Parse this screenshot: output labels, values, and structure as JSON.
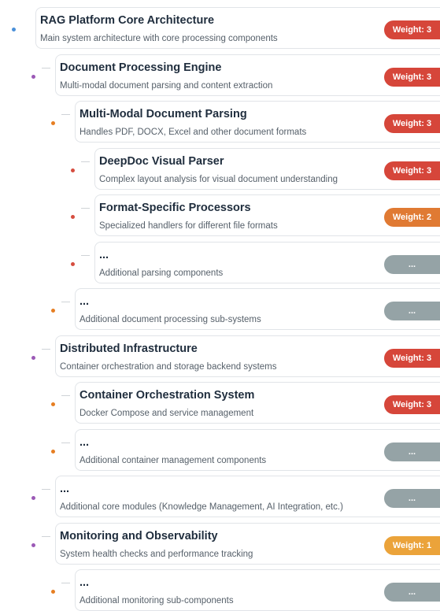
{
  "colors": {
    "dot_root": "#4a90d9",
    "dot_level1": "#9b59b6",
    "dot_level2": "#e67e22",
    "dot_level3": "#d64d3f",
    "badge_weight_3": "#d6463a",
    "badge_weight_2": "#e07a33",
    "badge_weight_1": "#eba33a",
    "badge_more": "#95a3a6"
  },
  "nodes": [
    {
      "level": 0,
      "title": "RAG Platform Core Architecture",
      "description": "Main system architecture with core processing components",
      "badge": "Weight: 3",
      "badge_kind": "weight_3"
    },
    {
      "level": 1,
      "title": "Document Processing Engine",
      "description": "Multi-modal document parsing and content extraction",
      "badge": "Weight: 3",
      "badge_kind": "weight_3"
    },
    {
      "level": 2,
      "title": "Multi-Modal Document Parsing",
      "description": "Handles PDF, DOCX, Excel and other document formats",
      "badge": "Weight: 3",
      "badge_kind": "weight_3"
    },
    {
      "level": 3,
      "title": "DeepDoc Visual Parser",
      "description": "Complex layout analysis for visual document understanding",
      "badge": "Weight: 3",
      "badge_kind": "weight_3"
    },
    {
      "level": 3,
      "title": "Format-Specific Processors",
      "description": "Specialized handlers for different file formats",
      "badge": "Weight: 2",
      "badge_kind": "weight_2"
    },
    {
      "level": 3,
      "title": "...",
      "description": "Additional parsing components",
      "badge": "...",
      "badge_kind": "more"
    },
    {
      "level": 2,
      "title": "...",
      "description": "Additional document processing sub-systems",
      "badge": "...",
      "badge_kind": "more"
    },
    {
      "level": 1,
      "title": "Distributed Infrastructure",
      "description": "Container orchestration and storage backend systems",
      "badge": "Weight: 3",
      "badge_kind": "weight_3"
    },
    {
      "level": 2,
      "title": "Container Orchestration System",
      "description": "Docker Compose and service management",
      "badge": "Weight: 3",
      "badge_kind": "weight_3"
    },
    {
      "level": 2,
      "title": "...",
      "description": "Additional container management components",
      "badge": "...",
      "badge_kind": "more"
    },
    {
      "level": 1,
      "title": "...",
      "description": "Additional core modules (Knowledge Management, AI Integration, etc.)",
      "badge": "...",
      "badge_kind": "more"
    },
    {
      "level": 1,
      "title": "Monitoring and Observability",
      "description": "System health checks and performance tracking",
      "badge": "Weight: 1",
      "badge_kind": "weight_1"
    },
    {
      "level": 2,
      "title": "...",
      "description": "Additional monitoring sub-components",
      "badge": "...",
      "badge_kind": "more"
    }
  ]
}
